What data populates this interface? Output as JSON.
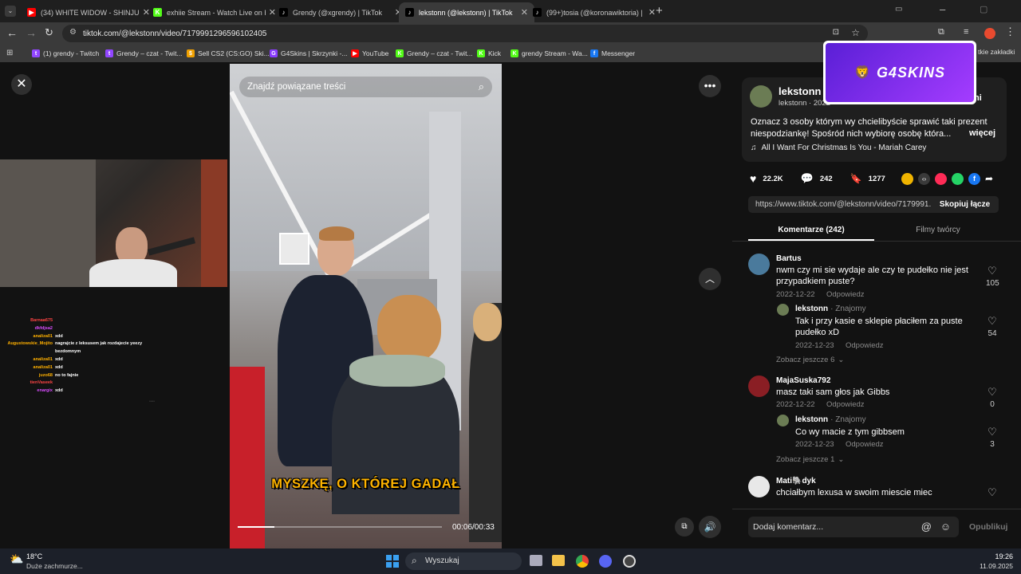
{
  "browser": {
    "tabs": [
      {
        "label": "(34) WHITE WIDOW - SHINJUKU",
        "icon": "youtube-icon",
        "color": "#ff0000",
        "glyph": "▶"
      },
      {
        "label": "exhiie Stream - Watch Live on Kick",
        "icon": "kick-icon",
        "color": "#53fc18",
        "glyph": "K"
      },
      {
        "label": "Grendy (@xgrendy) | TikTok",
        "icon": "tiktok-icon",
        "color": "#000000",
        "glyph": "♪"
      },
      {
        "label": "lekstonn (@lekstonn) | TikTok",
        "icon": "tiktok-icon",
        "color": "#000000",
        "glyph": "♪"
      },
      {
        "label": "(99+)tosia (@koronawiktoria) |",
        "icon": "tiktok-icon",
        "color": "#000000",
        "glyph": "♪"
      }
    ],
    "url": "tiktok.com/@lekstonn/video/7179991296596102405",
    "bookmarks": [
      {
        "label": "(1) grendy - Twitch",
        "color": "#9146ff",
        "glyph": "t"
      },
      {
        "label": "Grendy – czat - Twit...",
        "color": "#9146ff",
        "glyph": "t"
      },
      {
        "label": "Sell CS2 (CS:GO) Ski...",
        "color": "#f0a000",
        "glyph": "$"
      },
      {
        "label": "G4Skins | Skrzynki -...",
        "color": "#8a3cff",
        "glyph": "G"
      },
      {
        "label": "YouTube",
        "color": "#ff0000",
        "glyph": "▶"
      },
      {
        "label": "Grendy – czat - Twit...",
        "color": "#53fc18",
        "glyph": "K"
      },
      {
        "label": "Kick",
        "color": "#53fc18",
        "glyph": "K"
      },
      {
        "label": "grendy Stream - Wa...",
        "color": "#53fc18",
        "glyph": "K"
      },
      {
        "label": "Messenger",
        "color": "#1877f2",
        "glyph": "f"
      }
    ],
    "bookmarks_more": "tkie zakładki"
  },
  "overlay": {
    "banner_text": "G4SKINS",
    "chat": [
      {
        "user": "Barnaa675",
        "msg": "",
        "color": "#ff4444"
      },
      {
        "user": "dkfdjsa2",
        "msg": "",
        "color": "#d94dff"
      },
      {
        "user": "analiza01",
        "msg": "xdd",
        "color": "#ffb000"
      },
      {
        "user": "Augustowskie_Mojito",
        "msg": "nagrajcie z leksusem jak rozdajecie yeezy",
        "color": "#ffb000"
      },
      {
        "user": "",
        "msg": "bezdomnym",
        "color": "#ffffff"
      },
      {
        "user": "analiza01",
        "msg": "xdd",
        "color": "#ffb000"
      },
      {
        "user": "analiza01",
        "msg": "xdd",
        "color": "#ffb000"
      },
      {
        "user": "juzo68",
        "msg": "no to fajnie",
        "color": "#ffb000"
      },
      {
        "user": "tienVaseek",
        "msg": "",
        "color": "#ff4444"
      },
      {
        "user": "enargix",
        "msg": "xdd",
        "color": "#d94dff"
      }
    ]
  },
  "video": {
    "search_placeholder": "Znajdź powiązane treści",
    "caption": "MYSZKĘ, O KTÓREJ GADAŁ",
    "time": "00:06/00:33",
    "progress": 0.18
  },
  "author": {
    "name": "lekstonn",
    "sub": "lekstonn · 2022",
    "follow_label": "mi",
    "description": "Oznacz 3 osoby którym wy chcielibyście sprawić taki prezent niespodziankę! Spośród nich wybiorę osobę która...",
    "more_label": "więcej",
    "music": "All I Want For Christmas Is You - Mariah Carey"
  },
  "stats": {
    "likes": "22.2K",
    "comments": "242",
    "saves": "1277"
  },
  "share": {
    "link": "https://www.tiktok.com/@lekstonn/video/7179991...",
    "copy_label": "Skopiuj łącze"
  },
  "tabs": {
    "comments": "Komentarze (242)",
    "creator": "Filmy twórcy"
  },
  "comments": [
    {
      "user": "Bartus",
      "text": "nwm czy mi sie wydaje ale czy te pudełko nie jest przypadkiem puste?",
      "date": "2022-12-22",
      "reply": "Odpowiedz",
      "likes": "105"
    },
    {
      "user": "lekstonn",
      "badge": "· Znajomy",
      "text": "Tak i przy kasie e sklepie płaciłem za puste pudełko xD",
      "date": "2022-12-23",
      "reply": "Odpowiedz",
      "likes": "54",
      "more": "Zobacz jeszcze 6"
    },
    {
      "user": "MajaSuska792",
      "text": "masz taki sam głos jak Gibbs",
      "date": "2022-12-22",
      "reply": "Odpowiedz",
      "likes": "0"
    },
    {
      "user": "lekstonn",
      "badge": "· Znajomy",
      "text": "Co wy macie z tym gibbsem",
      "date": "2022-12-23",
      "reply": "Odpowiedz",
      "likes": "3",
      "more": "Zobacz jeszcze 1"
    },
    {
      "user": "Mati🐘dyk",
      "text": "chciałbym lexusa w swoim miescie miec",
      "date": "",
      "reply": "",
      "likes": ""
    }
  ],
  "composer": {
    "placeholder": "Dodaj komentarz...",
    "publish_label": "Opublikuj"
  },
  "taskbar": {
    "weather_temp": "18°C",
    "weather_desc": "Duże zachmurze...",
    "search_label": "Wyszukaj",
    "time": "19:26",
    "date": "11.09.2025"
  }
}
